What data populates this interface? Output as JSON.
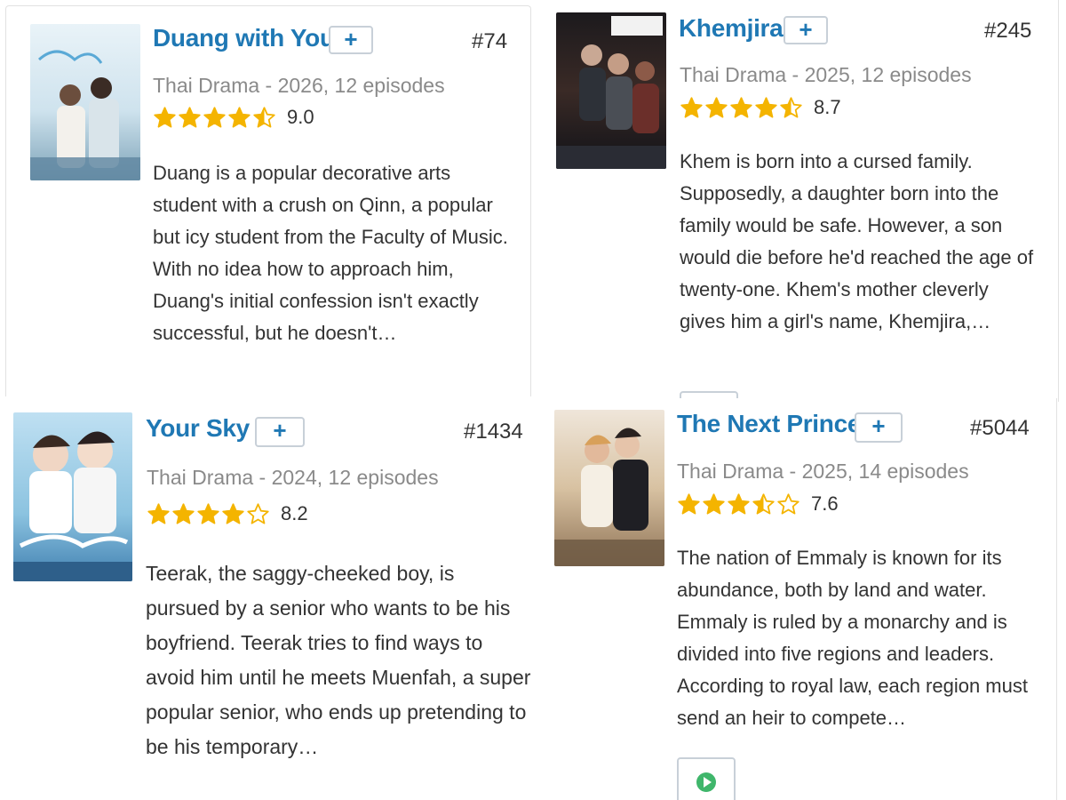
{
  "colors": {
    "title": "#1f78b4",
    "star": "#f4b400",
    "meta": "#8a8a8a",
    "play": "#3fb66b"
  },
  "cards": [
    {
      "title": "Duang with You",
      "add_label": "+",
      "rank": "#74",
      "meta": "Thai Drama - 2026, 12 episodes",
      "stars": 4.5,
      "score": "9.0",
      "description": "Duang is a popular decorative arts student with a crush on Qinn, a popular but icy student from the Faculty of Music. With no idea how to approach him, Duang's initial confession isn't exactly successful, but he doesn't…",
      "poster_icon": "drama-poster-image"
    },
    {
      "title": "Khemjira",
      "add_label": "+",
      "rank": "#245",
      "meta": "Thai Drama - 2025, 12 episodes",
      "stars": 4.5,
      "score": "8.7",
      "description": "Khem is born into a cursed family. Supposedly, a daughter born into the family would be safe. However, a son would die before he'd reached the age of twenty-one. Khem's mother cleverly gives him a girl's name, Khemjira,…",
      "poster_icon": "drama-poster-image"
    },
    {
      "title": "Your Sky",
      "add_label": "+",
      "rank": "#1434",
      "meta": "Thai Drama - 2024, 12 episodes",
      "stars": 4,
      "score": "8.2",
      "description": "Teerak, the saggy-cheeked boy, is pursued by a senior who wants to be his boyfriend. Teerak tries to find ways to avoid him until he meets Muenfah, a super popular senior, who ends up pretending to be his temporary…",
      "poster_icon": "drama-poster-image"
    },
    {
      "title": "The Next Prince",
      "add_label": "+",
      "rank": "#5044",
      "meta": "Thai Drama - 2025, 14 episodes",
      "stars": 3.5,
      "score": "7.6",
      "description": "The nation of Emmaly is known for its abundance, both by land and water. Emmaly is ruled by a monarchy and is divided into five regions and leaders. According to royal law, each region must send an heir to compete…",
      "poster_icon": "drama-poster-image",
      "watch_icon": "play-icon"
    }
  ]
}
